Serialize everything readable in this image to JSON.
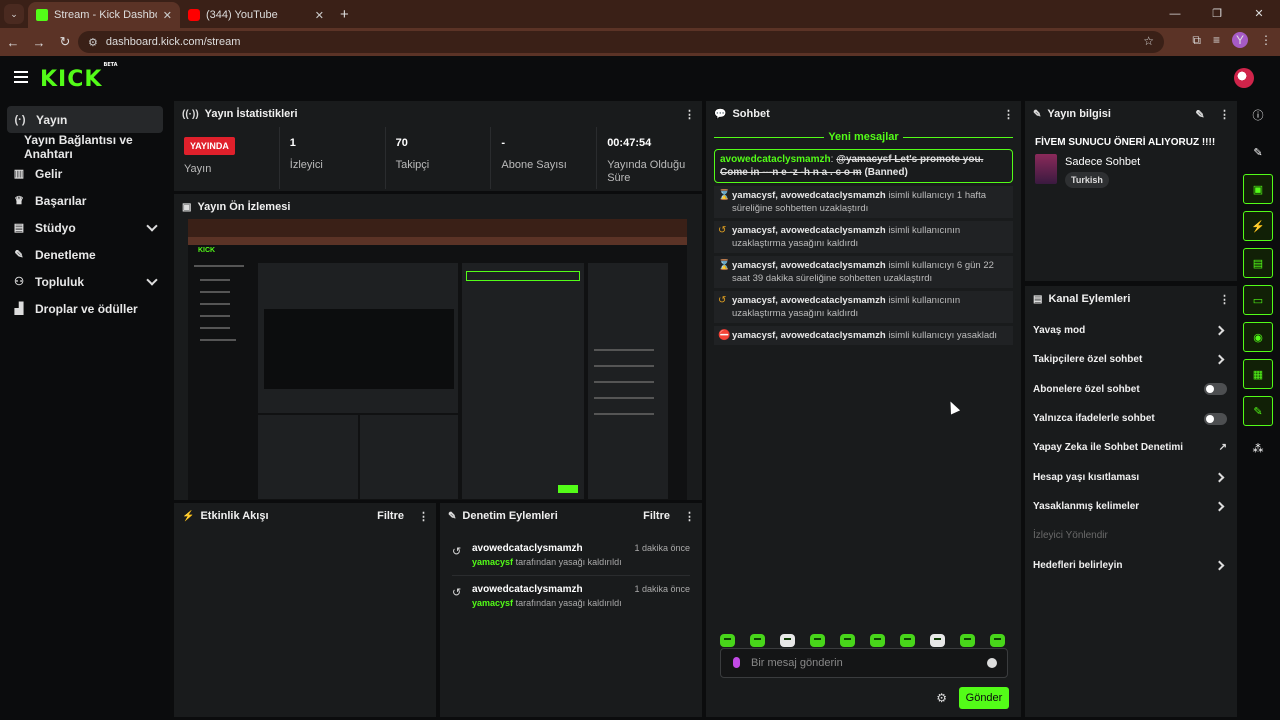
{
  "browser": {
    "tabs": [
      {
        "title": "Stream - Kick Dashboard",
        "active": true,
        "favicon": "kick-icon"
      },
      {
        "title": "(344) YouTube",
        "active": false,
        "favicon": "youtube-icon"
      }
    ],
    "url": "dashboard.kick.com/stream",
    "profile_initial": "Y"
  },
  "app": {
    "logo": "KICK",
    "logo_tag": "BETA"
  },
  "sidebar": {
    "items": [
      {
        "label": "Yayın",
        "icon": "broadcast-icon",
        "active": true
      },
      {
        "label": "Yayın Bağlantısı ve Anahtarı",
        "sub": true
      },
      {
        "label": "Gelir",
        "icon": "chart-icon"
      },
      {
        "label": "Başarılar",
        "icon": "trophy-icon"
      },
      {
        "label": "Stüdyo",
        "icon": "studio-icon",
        "expandable": true
      },
      {
        "label": "Denetleme",
        "icon": "wrench-icon"
      },
      {
        "label": "Topluluk",
        "icon": "users-icon",
        "expandable": true
      },
      {
        "label": "Droplar ve ödüller",
        "icon": "gift-icon"
      }
    ]
  },
  "stats_panel": {
    "title": "Yayın İstatistikleri",
    "live_badge": "YAYINDA",
    "live_label": "Yayın",
    "stats": [
      {
        "value": "1",
        "label": "İzleyici"
      },
      {
        "value": "70",
        "label": "Takipçi"
      },
      {
        "value": "-",
        "label": "Abone Sayısı"
      },
      {
        "value": "00:47:54",
        "label": "Yayında Olduğu Süre"
      }
    ]
  },
  "preview_panel": {
    "title": "Yayın Ön İzlemesi"
  },
  "activity_panel": {
    "title": "Etkinlik Akışı",
    "filter": "Filtre"
  },
  "mod_actions_panel": {
    "title": "Denetim Eylemleri",
    "filter": "Filtre",
    "items": [
      {
        "user": "avowedcataclysmamzh",
        "by": "yamacysf",
        "desc": "tarafından yasağı kaldırıldı",
        "time": "1 dakika önce"
      },
      {
        "user": "avowedcataclysmamzh",
        "by": "yamacysf",
        "desc": "tarafından yasağı kaldırıldı",
        "time": "1 dakika önce"
      }
    ]
  },
  "chat_panel": {
    "title": "Sohbet",
    "new_messages": "Yeni mesajlar",
    "highlight": {
      "user": "avowedcataclysmamzh",
      "text": "@yamacysf Let's promote you. Come in ---n e -z -h n a . c o m",
      "status": "(Banned)"
    },
    "mod_messages": [
      {
        "icon": "hourglass-icon",
        "actors": "yamacysf, avowedcataclysmamzh",
        "text": "isimli kullanıcıyı 1 hafta süreliğine sohbetten uzaklaştırdı"
      },
      {
        "icon": "undo-icon",
        "actors": "yamacysf, avowedcataclysmamzh",
        "text": "isimli kullanıcının uzaklaştırma yasağını kaldırdı"
      },
      {
        "icon": "hourglass-icon",
        "actors": "yamacysf, avowedcataclysmamzh",
        "text": "isimli kullanıcıyı 6 gün 22 saat 39 dakika süreliğine sohbetten uzaklaştırdı"
      },
      {
        "icon": "undo-icon",
        "actors": "yamacysf, avowedcataclysmamzh",
        "text": "isimli kullanıcının uzaklaştırma yasağını kaldırdı"
      },
      {
        "icon": "ban-icon",
        "actors": "yamacysf, avowedcataclysmamzh",
        "text": "isimli kullanıcıyı yasakladı"
      }
    ],
    "input_placeholder": "Bir mesaj gönderin",
    "send_label": "Gönder"
  },
  "stream_info": {
    "title": "Yayın bilgisi",
    "stream_title": "FİVEM SUNUCU ÖNERİ ALIYORUZ !!!!",
    "category": "Sadece Sohbet",
    "tag": "Turkish"
  },
  "channel_actions": {
    "title": "Kanal Eylemleri",
    "items": [
      {
        "label": "Yavaş mod",
        "control": "chevron"
      },
      {
        "label": "Takipçilere özel sohbet",
        "control": "chevron"
      },
      {
        "label": "Abonelere özel sohbet",
        "control": "toggle"
      },
      {
        "label": "Yalnızca ifadelerle sohbet",
        "control": "toggle"
      },
      {
        "label": "Yapay Zeka ile Sohbet Denetimi",
        "control": "external"
      },
      {
        "label": "Hesap yaşı kısıtlaması",
        "control": "chevron"
      },
      {
        "label": "Yasaklanmış kelimeler",
        "control": "chevron"
      },
      {
        "label": "İzleyici Yönlendir",
        "control": "none",
        "disabled": true
      },
      {
        "label": "Hedefleri belirleyin",
        "control": "chevron"
      }
    ]
  },
  "colors": {
    "accent": "#53fc18",
    "live": "#e0202b",
    "panel": "#191b1c"
  }
}
